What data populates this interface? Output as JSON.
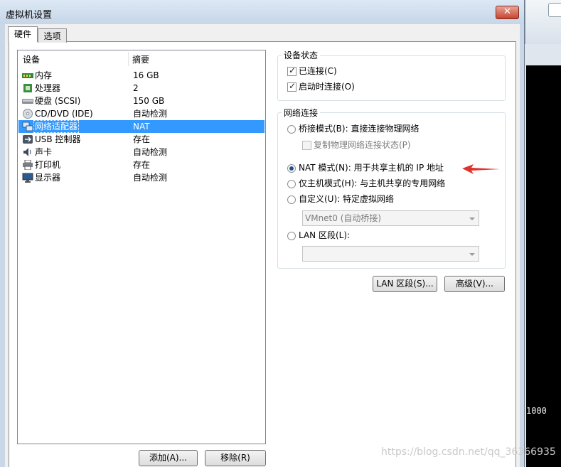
{
  "window": {
    "title": "虚拟机设置",
    "close_glyph": "✕"
  },
  "tabs": [
    {
      "label": "硬件"
    },
    {
      "label": "选项"
    }
  ],
  "device_list": {
    "columns": {
      "device": "设备",
      "summary": "摘要"
    },
    "rows": [
      {
        "name": "内存",
        "summary": "16 GB",
        "icon": "memory-icon"
      },
      {
        "name": "处理器",
        "summary": "2",
        "icon": "processor-icon"
      },
      {
        "name": "硬盘 (SCSI)",
        "summary": "150 GB",
        "icon": "harddisk-icon"
      },
      {
        "name": "CD/DVD (IDE)",
        "summary": "自动检测",
        "icon": "cdrom-icon"
      },
      {
        "name": "网络适配器",
        "summary": "NAT",
        "icon": "network-adapter-icon",
        "selected": true
      },
      {
        "name": "USB 控制器",
        "summary": "存在",
        "icon": "usb-icon"
      },
      {
        "name": "声卡",
        "summary": "自动检测",
        "icon": "sound-icon"
      },
      {
        "name": "打印机",
        "summary": "存在",
        "icon": "printer-icon"
      },
      {
        "name": "显示器",
        "summary": "自动检测",
        "icon": "display-icon"
      }
    ],
    "add_button": "添加(A)...",
    "remove_button": "移除(R)"
  },
  "device_status": {
    "title": "设备状态",
    "connected": {
      "label": "已连接(C)",
      "checked": true
    },
    "connect_at_power_on": {
      "label": "启动时连接(O)",
      "checked": true
    }
  },
  "network_connection": {
    "title": "网络连接",
    "bridged": {
      "label": "桥接模式(B): 直接连接物理网络",
      "selected": false
    },
    "replicate_state": {
      "label": "复制物理网络连接状态(P)",
      "checked": false,
      "enabled": false
    },
    "nat": {
      "label": "NAT 模式(N): 用于共享主机的 IP 地址",
      "selected": true
    },
    "host_only": {
      "label": "仅主机模式(H): 与主机共享的专用网络",
      "selected": false
    },
    "custom": {
      "label": "自定义(U): 特定虚拟网络",
      "selected": false
    },
    "custom_select_value": "VMnet0 (自动桥接)",
    "lan_segment": {
      "label": "LAN 区段(L):",
      "selected": false
    },
    "lan_select_value": ""
  },
  "buttons": {
    "lan_segments": "LAN 区段(S)...",
    "advanced": "高级(V)..."
  },
  "background_terminal_text": "1000",
  "watermark": "https://blog.csdn.net/qq_36366935",
  "colors": {
    "selection": "#3399ff",
    "annotation_arrow": "#e0322d"
  }
}
